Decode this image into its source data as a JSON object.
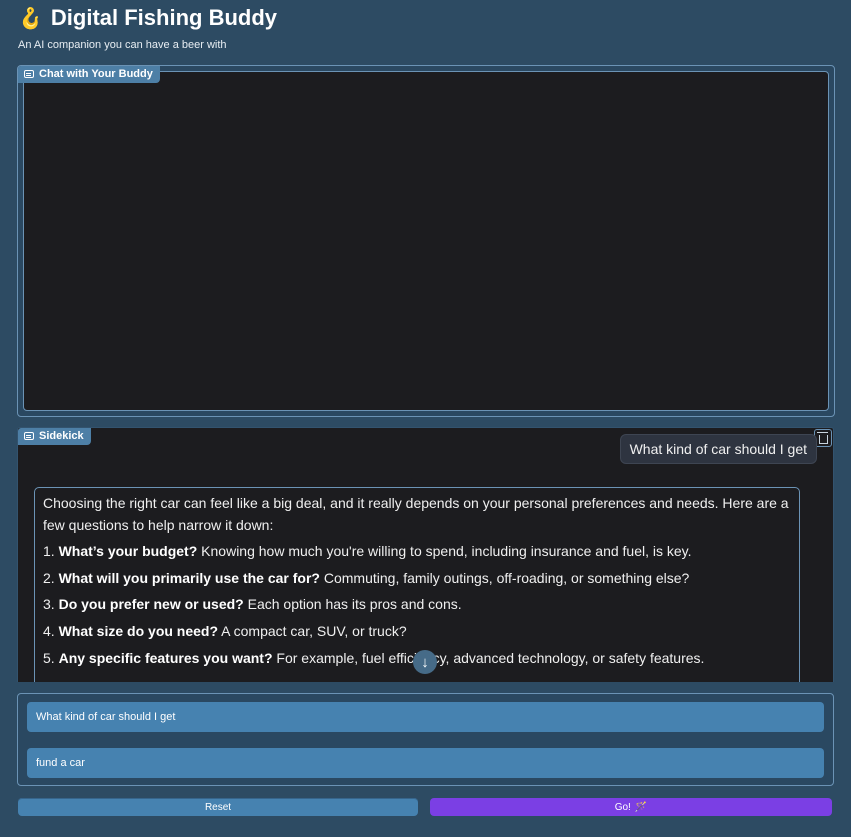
{
  "app": {
    "title": "Digital Fishing Buddy",
    "subtitle": "An AI companion you can have a beer with",
    "title_icon": "fishing-hook-icon"
  },
  "chat_panel": {
    "label": "Chat with Your Buddy"
  },
  "sidekick_panel": {
    "label": "Sidekick",
    "user_message": "What kind of car should I get",
    "bot_intro": "Choosing the right car can feel like a big deal, and it really depends on your personal preferences and needs. Here are a few questions to help narrow it down:",
    "bot_items": [
      {
        "num": "1.",
        "bold": "What’s your budget?",
        "text": " Knowing how much you're willing to spend, including insurance and fuel, is key."
      },
      {
        "num": "2.",
        "bold": "What will you primarily use the car for?",
        "text": " Commuting, family outings, off-roading, or something else?"
      },
      {
        "num": "3.",
        "bold": "Do you prefer new or used?",
        "text": " Each option has its pros and cons."
      },
      {
        "num": "4.",
        "bold": "What size do you need?",
        "text": " A compact car, SUV, or truck?"
      },
      {
        "num": "5.",
        "bold": "Any specific features you want?",
        "text": " For example, fuel efficiency, advanced technology, or safety features."
      }
    ]
  },
  "inputs": {
    "message_value": "What kind of car should I get",
    "criteria_value": "fund a car"
  },
  "buttons": {
    "reset": "Reset",
    "go": "Go!",
    "go_emoji": "🪄"
  },
  "colors": {
    "background": "#2d4b63",
    "accent_blue": "#4682b0",
    "go_purple": "#7b3fe4"
  }
}
